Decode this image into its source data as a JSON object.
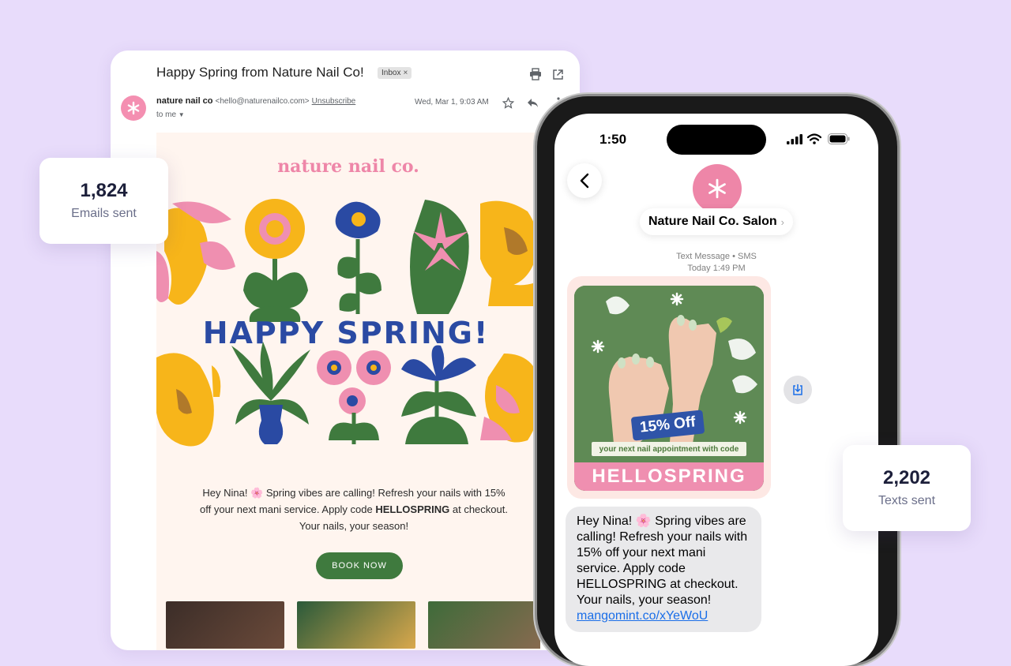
{
  "email": {
    "subject": "Happy Spring from Nature Nail Co!",
    "label_chip": "Inbox",
    "sender_name": "nature nail co",
    "sender_address": "<hello@naturenailco.com>",
    "unsubscribe": "Unsubscribe",
    "date": "Wed, Mar 1, 9:03 AM",
    "recipient": "to me",
    "newsletter": {
      "brand": "nature nail co.",
      "headline": "HAPPY SPRING!",
      "body_lines": [
        "Hey Nina! 🌸 Spring vibes are calling! Refresh your nails with 15%",
        "off your next mani service. Apply code ",
        "HELLOSPRING",
        " at checkout.",
        "Your nails, your season!"
      ],
      "cta": "BOOK NOW"
    }
  },
  "stats": {
    "emails": {
      "value": "1,824",
      "label": "Emails sent"
    },
    "texts": {
      "value": "2,202",
      "label": "Texts sent"
    }
  },
  "phone": {
    "time": "1:50",
    "contact_name": "Nature Nail Co. Salon",
    "contact_chevron": "›",
    "message_type": "Text Message • SMS",
    "message_time": "Today 1:49 PM",
    "promo": {
      "discount": "15% Off",
      "subtitle": "your next nail appointment with code",
      "code": "HELLOSPRING"
    },
    "sms_text": "Hey Nina! 🌸 Spring vibes are calling! Refresh your nails with 15% off your next mani service. Apply code HELLOSPRING at checkout. Your nails, your season! ",
    "sms_link": "mangomint.co/xYeWoU"
  },
  "colors": {
    "background": "#e8dcfb",
    "brand_pink": "#ee86a8",
    "headline_blue": "#2a4aa3",
    "button_green": "#3f7a3e",
    "link_blue": "#1a6ee8"
  },
  "icons": [
    "print-icon",
    "open-in-new-icon",
    "star-icon",
    "reply-icon",
    "more-vert-icon",
    "back-chevron-icon",
    "signal-icon",
    "wifi-icon",
    "battery-icon",
    "save-image-icon",
    "asterisk-logo-icon"
  ]
}
